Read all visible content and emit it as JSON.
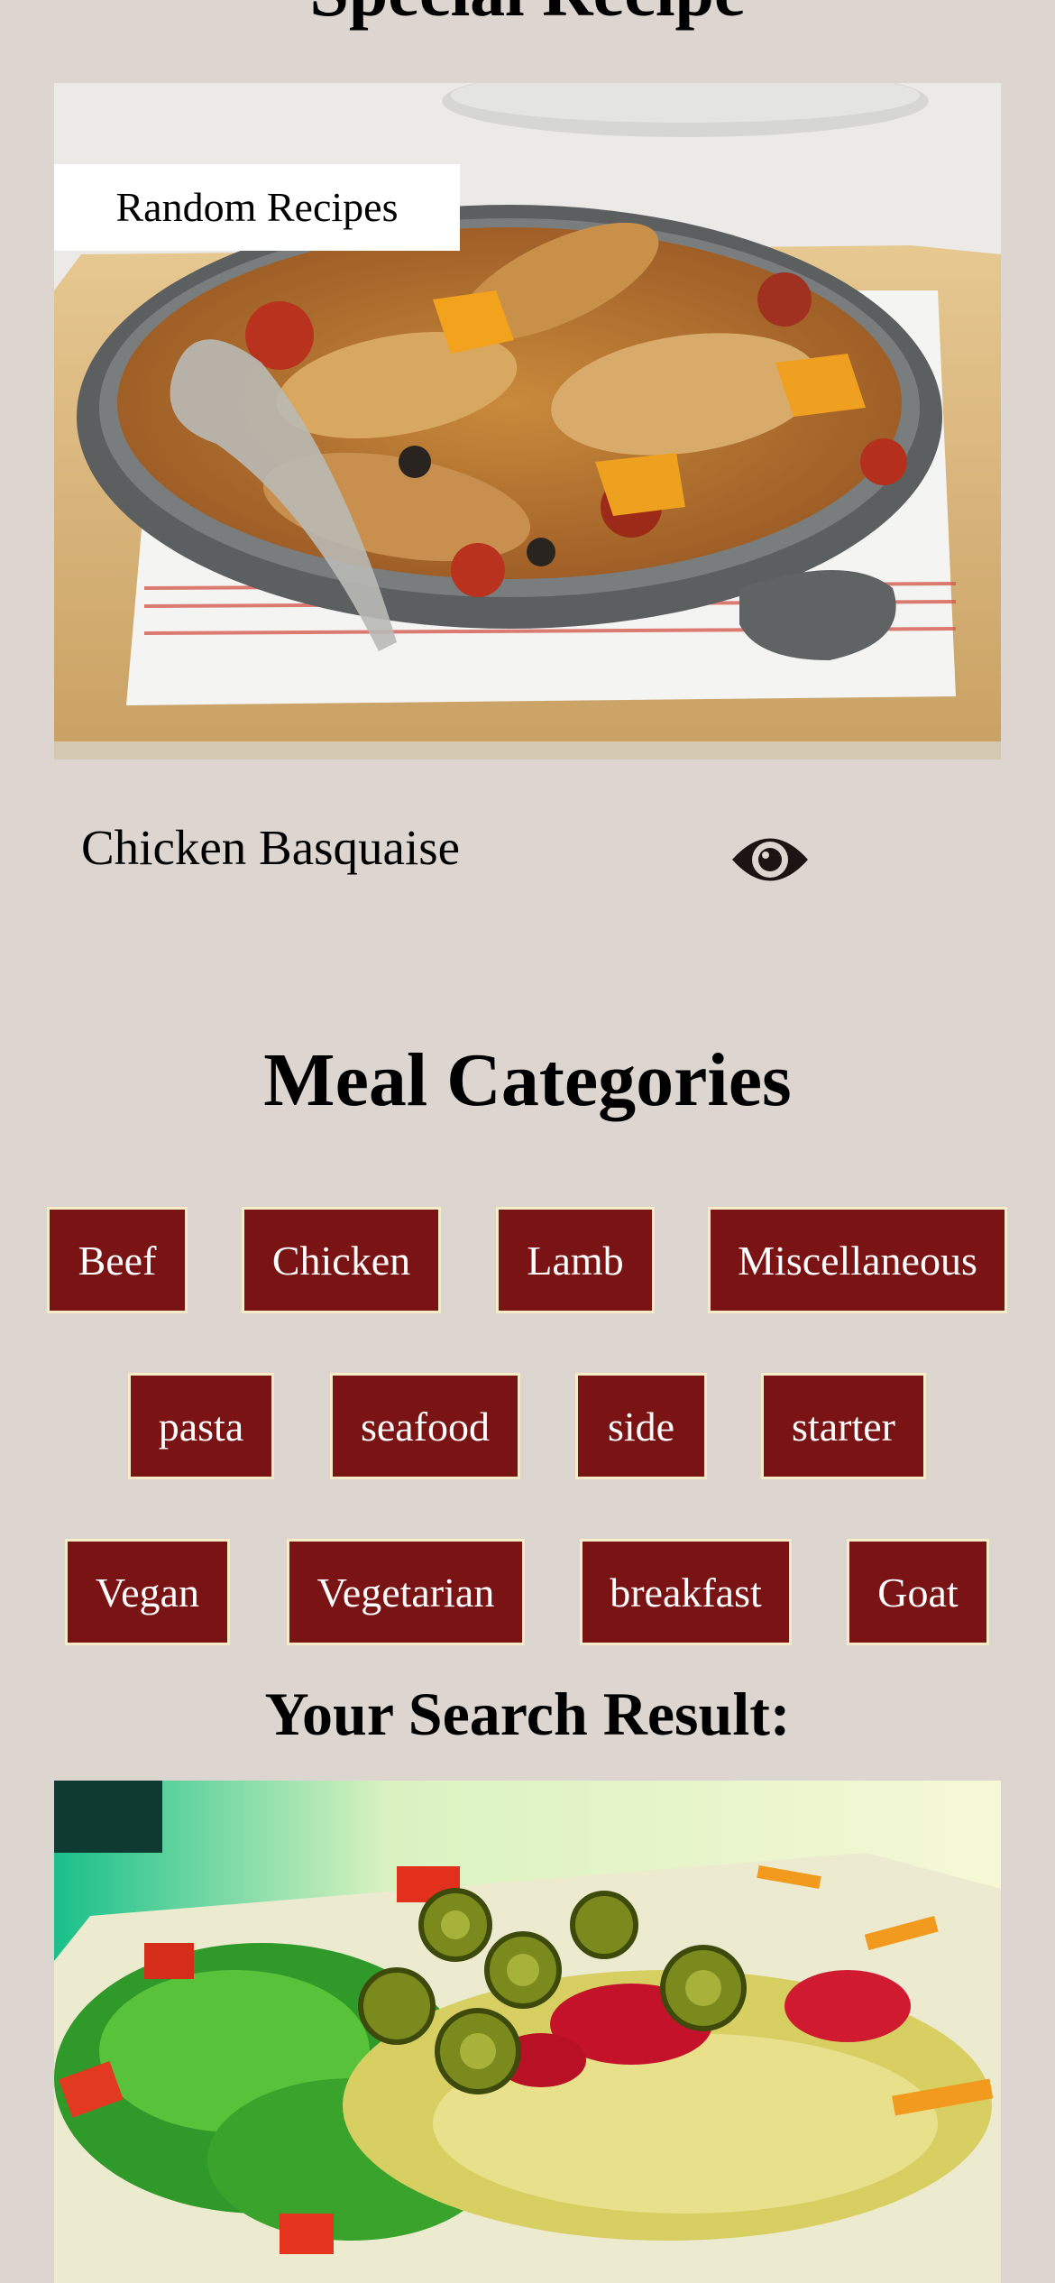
{
  "page": {
    "title": "Special Recipe"
  },
  "random_recipe": {
    "tag_label": "Random Recipes",
    "name": "Chicken Basquaise",
    "view_icon": "eye-icon"
  },
  "categories": {
    "heading": "Meal Categories",
    "rows": [
      [
        "Beef",
        "Chicken",
        "Lamb",
        "Miscellaneous"
      ],
      [
        "pasta",
        "seafood",
        "side",
        "starter"
      ],
      [
        "Vegan",
        "Vegetarian",
        "breakfast",
        "Goat"
      ]
    ]
  },
  "search": {
    "heading": "Your Search Result:"
  },
  "colors": {
    "background": "#ddd6d0",
    "category_button": "#7a1414",
    "category_border": "#f6ecc8"
  }
}
